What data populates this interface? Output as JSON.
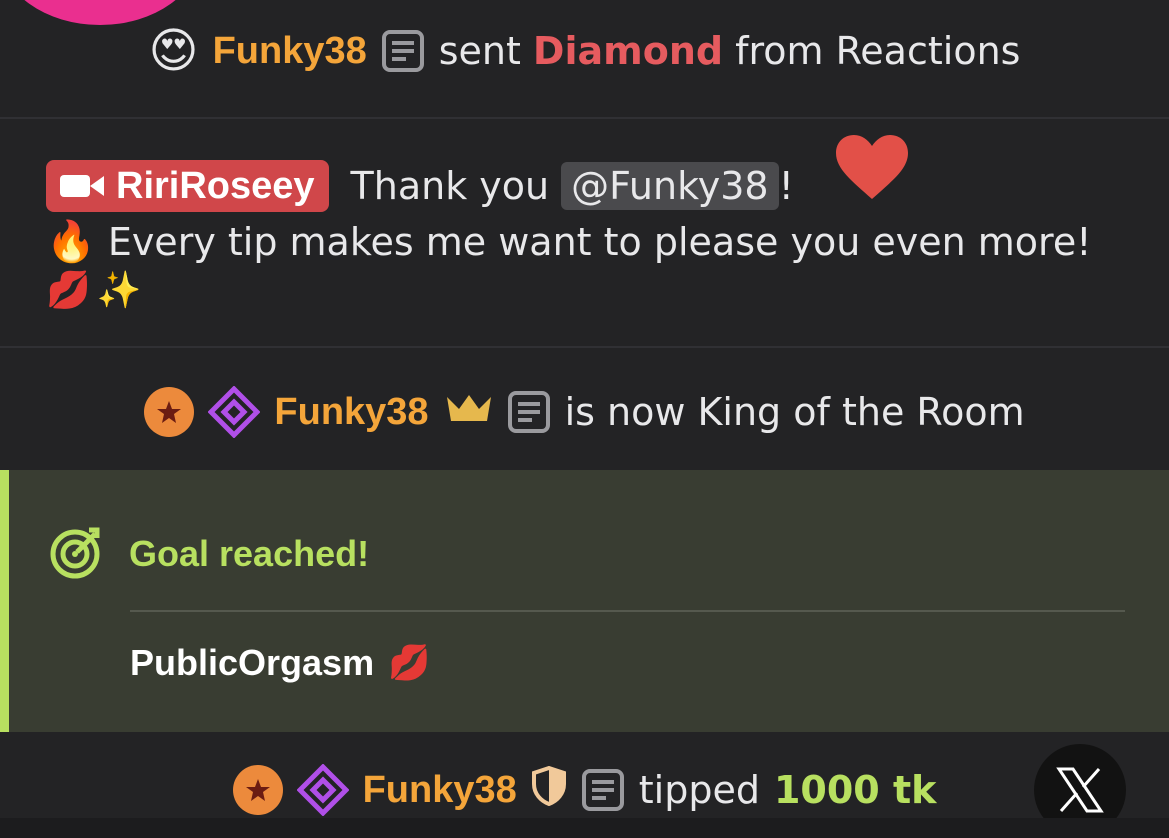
{
  "event_reaction": {
    "username": "Funky38",
    "text_before": "sent",
    "gift": "Diamond",
    "text_after": "from Reactions",
    "emoji_icon": "heart-eyes-emoji"
  },
  "message": {
    "author": "RiriRoseey",
    "thank_text": "Thank you",
    "mention": "@Funky38",
    "exclaim": "!",
    "line2": "Every tip makes me want to please you even more!",
    "icons": [
      "heart-icon",
      "fire-emoji",
      "kiss-emoji",
      "sparkles-emoji"
    ]
  },
  "event_king": {
    "username": "Funky38",
    "text": "is now King of the Room"
  },
  "goal": {
    "title": "Goal reached!",
    "name": "PublicOrgasm",
    "accent": "#b8e060"
  },
  "event_tip": {
    "username": "Funky38",
    "text": "tipped",
    "amount": "1000 tk"
  },
  "colors": {
    "username": "#f4a53a",
    "diamond": "#e65b5f",
    "author_bg": "#d0474a",
    "tip_amount": "#b8e060"
  }
}
